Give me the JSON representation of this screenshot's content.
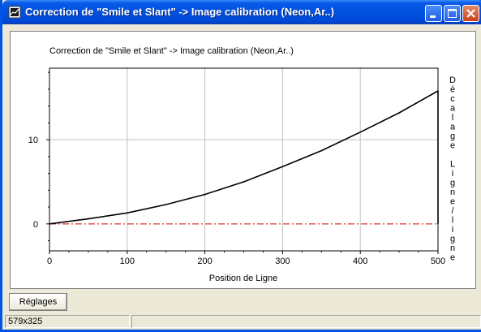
{
  "window": {
    "title": "Correction de \"Smile et Slant\" -> Image calibration (Neon,Ar..)"
  },
  "toolbar": {
    "settings_label": "Réglages"
  },
  "status": {
    "size_text": "579x325",
    "cell2_text": ""
  },
  "colors": {
    "title_bar": "#0050e0",
    "curve": "#000000",
    "zero_line": "#d00000",
    "grid": "#c0c0c0"
  },
  "chart_data": {
    "type": "line",
    "title": "Correction de \"Smile et Slant\" -> Image calibration (Neon,Ar..)",
    "xlabel": "Position de Ligne",
    "ylabel": "Décalage Ligne/ligne",
    "xlim": [
      0,
      500
    ],
    "ylim": [
      -3.2,
      18.5
    ],
    "xticks": [
      0,
      100,
      200,
      300,
      400,
      500
    ],
    "yticks": [
      0,
      10
    ],
    "grid": true,
    "series": [
      {
        "name": "",
        "style": "solid",
        "x": [
          0,
          50,
          100,
          150,
          200,
          250,
          300,
          350,
          400,
          450,
          500
        ],
        "y": [
          0.0,
          0.6,
          1.3,
          2.3,
          3.5,
          5.0,
          6.8,
          8.7,
          10.9,
          13.2,
          15.8
        ]
      },
      {
        "name": "",
        "style": "dash-dot",
        "x": [
          0,
          500
        ],
        "y": [
          0,
          0
        ]
      }
    ]
  }
}
